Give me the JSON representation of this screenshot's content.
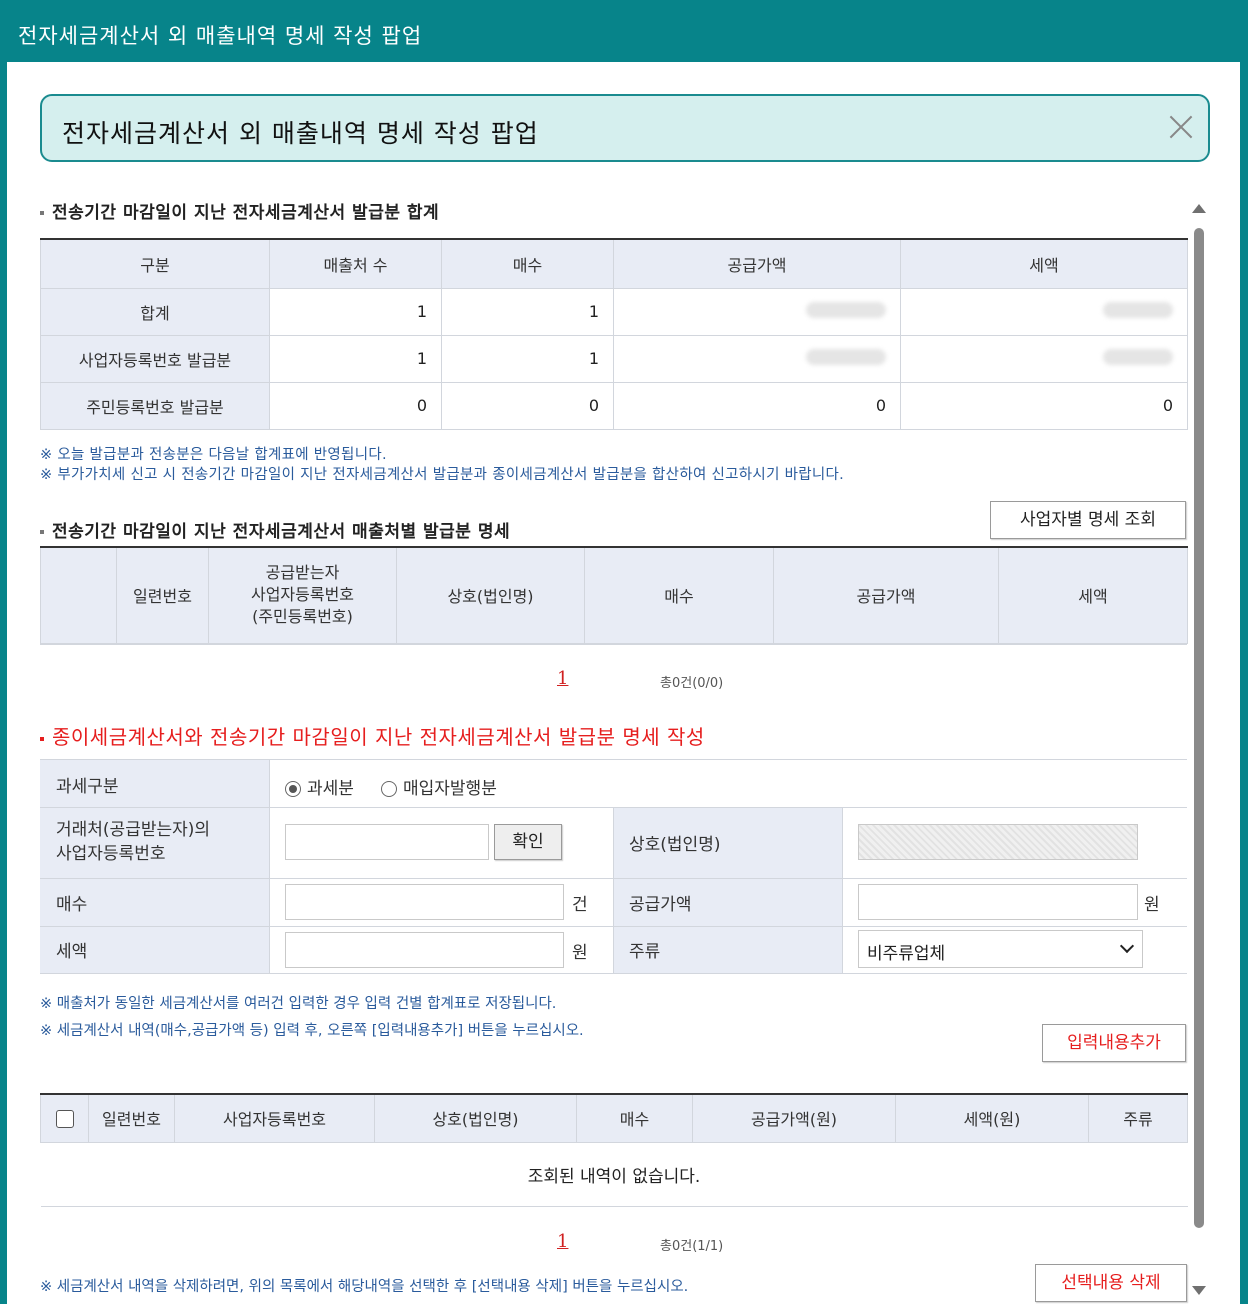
{
  "window": {
    "title": "전자세금계산서 외 매출내역 명세 작성 팝업"
  },
  "header": {
    "title": "전자세금계산서 외 매출내역 명세 작성 팝업"
  },
  "summary": {
    "section_title": "전송기간 마감일이 지난 전자세금계산서 발급분 합계",
    "columns": [
      "구분",
      "매출처 수",
      "매수",
      "공급가액",
      "세액"
    ],
    "rows": [
      {
        "label": "합계",
        "count": "1",
        "sheets": "1"
      },
      {
        "label": "사업자등록번호 발급분",
        "count": "1",
        "sheets": "1"
      },
      {
        "label": "주민등록번호 발급분",
        "count": "0",
        "sheets": "0",
        "supply": "0",
        "tax": "0"
      }
    ],
    "notes": [
      "※ 오늘 발급분과 전송분은 다음날 합계표에 반영됩니다.",
      "※ 부가가치세 신고 시 전송기간 마감일이 지난 전자세금계산서 발급분과 종이세금계산서 발급분을 합산하여 신고하시기 바랍니다."
    ]
  },
  "detail": {
    "section_title": "전송기간 마감일이 지난 전자세금계산서 매출처별 발급분 명세",
    "button": "사업자별 명세 조회",
    "columns": [
      "일련번호",
      "공급받는자 사업자등록번호 (주민등록번호)",
      "상호(법인명)",
      "매수",
      "공급가액",
      "세액"
    ],
    "col2_lines": [
      "공급받는자",
      "사업자등록번호",
      "(주민등록번호)"
    ],
    "pager_page": "1",
    "pager_total": "총0건(0/0)"
  },
  "form": {
    "section_title": "종이세금계산서와 전송기간 마감일이 지난 전자세금계산서 발급분 명세 작성",
    "tax_type_label": "과세구분",
    "tax_type_options": [
      "과세분",
      "매입자발행분"
    ],
    "partner_label_lines": [
      "거래처(공급받는자)의",
      "사업자등록번호"
    ],
    "confirm_button": "확인",
    "company_label": "상호(법인명)",
    "sheets_label": "매수",
    "sheets_unit": "건",
    "supply_label": "공급가액",
    "supply_unit": "원",
    "tax_label": "세액",
    "tax_unit": "원",
    "liquor_label": "주류",
    "liquor_selected": "비주류업체",
    "notes": [
      "※  매출처가 동일한 세금계산서를 여러건 입력한 경우 입력 건별 합계표로 저장됩니다.",
      "※  세금계산서 내역(매수,공급가액 등) 입력 후, 오른쪽 [입력내용추가] 버튼을 누르십시오."
    ],
    "add_button": "입력내용추가"
  },
  "list": {
    "columns": [
      "일련번호",
      "사업자등록번호",
      "상호(법인명)",
      "매수",
      "공급가액(원)",
      "세액(원)",
      "주류"
    ],
    "empty_message": "조회된 내역이 없습니다.",
    "pager_page": "1",
    "pager_total": "총0건(1/1)",
    "note": "※  세금계산서 내역을 삭제하려면, 위의 목록에서 해당내역을 선택한 후 [선택내용 삭제] 버튼을 누르십시오.",
    "delete_button": "선택내용 삭제"
  }
}
